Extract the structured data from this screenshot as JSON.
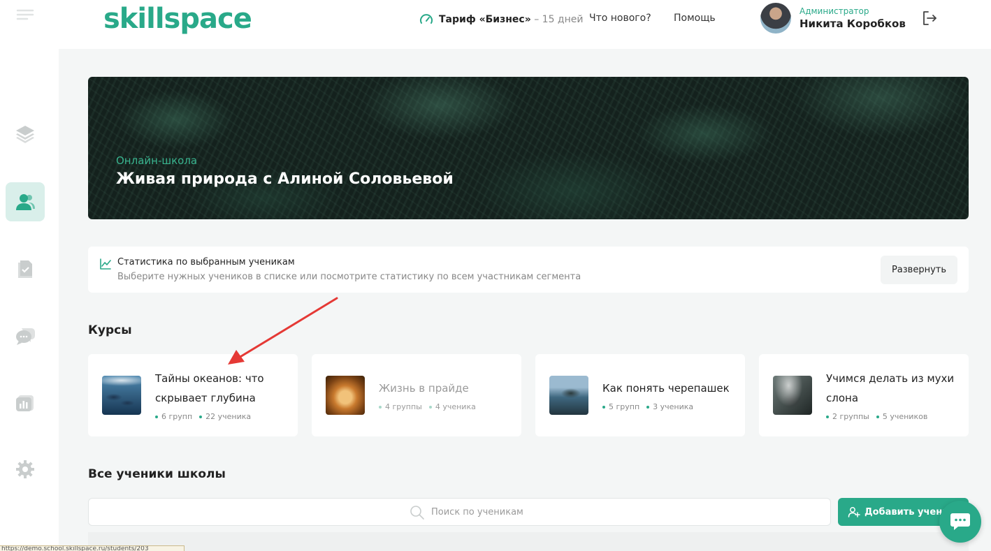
{
  "header": {
    "logo": "skillspace",
    "tariff_name": "Тариф «Бизнес»",
    "tariff_days": " – 15 дней",
    "whats_new": "Что нового?",
    "help": "Помощь",
    "user_role": "Администратор",
    "user_name": "Никита Коробков"
  },
  "hero": {
    "subtitle": "Онлайн-школа",
    "title": "Живая природа с Алиной Соловьевой"
  },
  "stats": {
    "title": "Статистика по выбранным ученикам",
    "description": "Выберите нужных учеников в списке или посмотрите статистику по всем участникам сегмента",
    "expand_label": "Развернуть"
  },
  "courses": {
    "title": "Курсы",
    "items": [
      {
        "title": "Тайны океанов: что скрывает глубина",
        "groups": "6 групп",
        "students": "22 ученика"
      },
      {
        "title": "Жизнь в прайде",
        "groups": "4 группы",
        "students": "4 ученика"
      },
      {
        "title": "Как понять черепашек",
        "groups": "5 групп",
        "students": "3 ученика"
      },
      {
        "title": "Учимся делать из мухи слона",
        "groups": "2 группы",
        "students": "5 учеников"
      }
    ]
  },
  "students": {
    "title": "Все ученики школы",
    "search_placeholder": "Поиск по ученикам",
    "add_label": "Добавить ученика"
  },
  "status_bar": {
    "url": "https://demo.school.skillspace.ru/students/203"
  },
  "colors": {
    "accent": "#29a989",
    "annotation": "#e53935"
  }
}
